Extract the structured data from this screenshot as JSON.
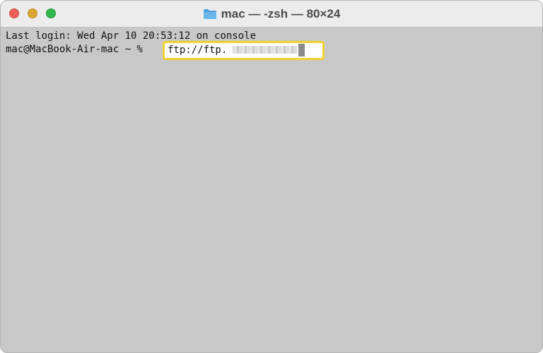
{
  "window": {
    "title": "mac — -zsh — 80×24"
  },
  "terminal": {
    "last_login": "Last login: Wed Apr 10 20:53:12 on console",
    "prompt": "mac@MacBook-Air-mac ~ % ",
    "command_visible": "ftp://ftp."
  },
  "icons": {
    "title_folder": "folder-icon",
    "close": "close-button",
    "minimize": "minimize-button",
    "zoom": "zoom-button"
  },
  "colors": {
    "highlight_border": "#f2d02e",
    "terminal_background": "#c8c8c8"
  }
}
